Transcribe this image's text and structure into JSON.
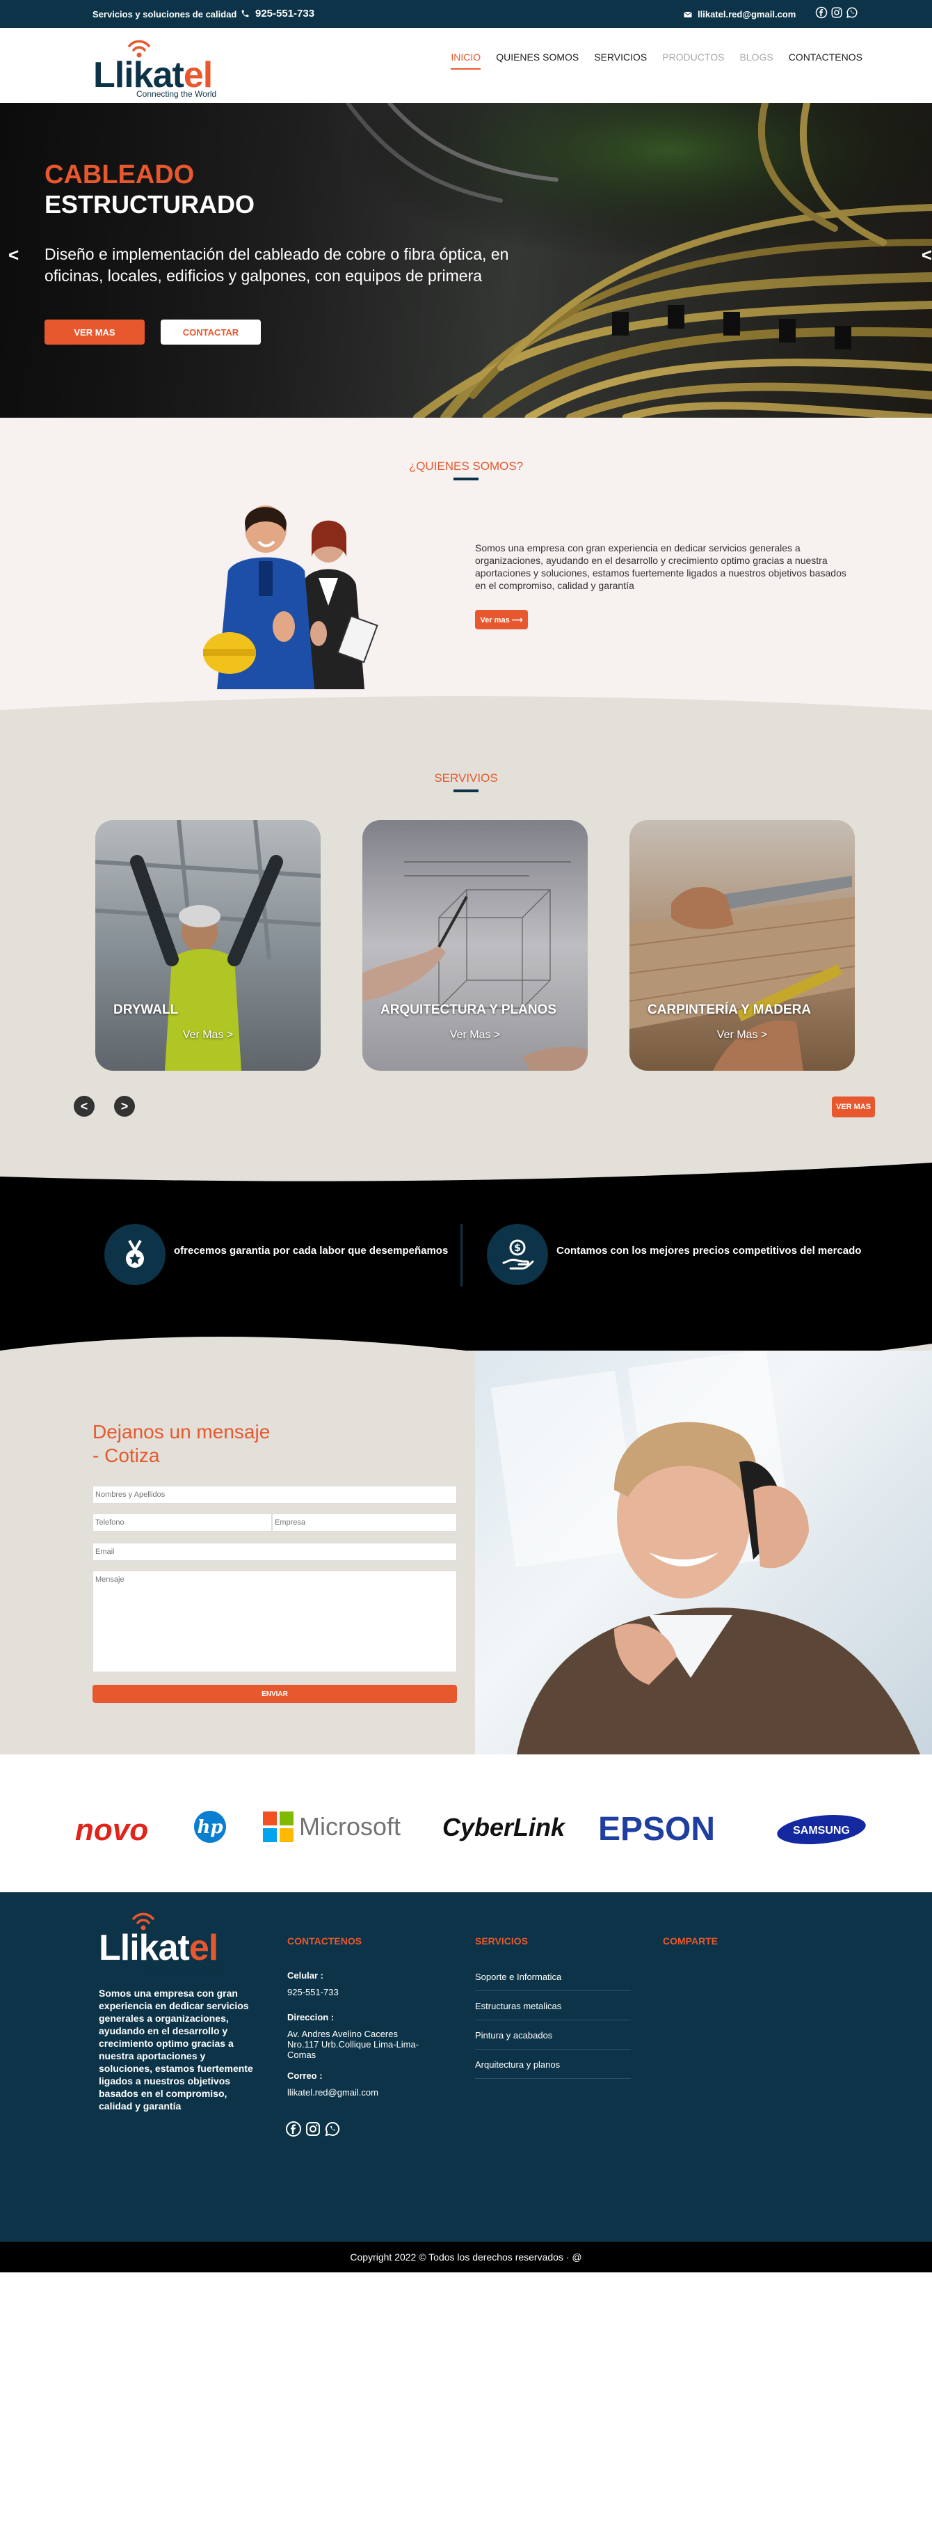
{
  "topbar": {
    "tagline": "Servicios y soluciones de calidad",
    "phone": "925-551-733",
    "email": "llikatel.red@gmail.com"
  },
  "header": {
    "logo_main": "Llikat",
    "logo_accent": "el",
    "logo_sub": "Connecting the World",
    "nav": [
      {
        "label": "INICIO"
      },
      {
        "label": "QUIENES SOMOS"
      },
      {
        "label": "SERVICIOS"
      },
      {
        "label": "PRODUCTOS"
      },
      {
        "label": "BLOGS"
      },
      {
        "label": "CONTACTENOS"
      }
    ]
  },
  "hero": {
    "title_1": "CABLEADO",
    "title_2": "ESTRUCTURADO",
    "description": "Diseño e implementación del cableado de cobre o fibra óptica, en oficinas, locales, edificios y galpones, con equipos de primera",
    "btn_primary": "VER MAS",
    "btn_secondary": "CONTACTAR",
    "prev": "<",
    "next": "<"
  },
  "about": {
    "title": "¿QUIENES SOMOS?",
    "text": "Somos una empresa con gran experiencia en dedicar servicios generales a organizaciones, ayudando en el desarrollo y crecimiento optimo gracias a nuestra aportaciones y soluciones, estamos fuertemente ligados a nuestros objetivos basados en el compromiso, calidad y garantía",
    "button": "Ver mas ⟶"
  },
  "services": {
    "title": "SERVIVIOS",
    "cards": [
      {
        "title": "DRYWALL",
        "link": "Ver Mas >"
      },
      {
        "title": "ARQUITECTURA Y PLANOS",
        "link": "Ver Mas >"
      },
      {
        "title": "CARPINTERÍA Y MADERA",
        "link": "Ver Mas >"
      }
    ],
    "prev": "<",
    "next": ">",
    "button": "VER MAS"
  },
  "features": [
    {
      "text": "ofrecemos garantia por cada labor que desempeñamos",
      "icon": "medal-icon"
    },
    {
      "text": "Contamos con los mejores precios competitivos del mercado",
      "icon": "money-hand-icon"
    }
  ],
  "contact": {
    "title_1": "Dejanos un mensaje",
    "title_2": "- Cotiza",
    "name_placeholder": "Nombres y Apellidos",
    "phone_placeholder": "Telefono",
    "company_placeholder": "Empresa",
    "email_placeholder": "Email",
    "message_placeholder": "Mensaje",
    "submit": "ENVIAR"
  },
  "brands": [
    "novo",
    "hp",
    "Microsoft",
    "CyberLink",
    "EPSON",
    "SAMSUNG"
  ],
  "footer": {
    "about": "Somos una empresa con gran experiencia en dedicar servicios generales a organizaciones, ayudando en el desarrollo y crecimiento optimo gracias a nuestra aportaciones y soluciones, estamos fuertemente ligados a nuestros objetivos basados en el compromiso, calidad y garantía",
    "contact_head": "CONTACTENOS",
    "cel_label": "Celular :",
    "cel_value": "925-551-733",
    "dir_label": "Direccion :",
    "dir_value": "Av. Andres Avelino Caceres Nro.117 Urb.Collique Lima-Lima-Comas",
    "mail_label": "Correo :",
    "mail_value": "llikatel.red@gmail.com",
    "services_head": "SERVICIOS",
    "services": [
      "Soporte e Informatica",
      "Estructuras metalicas",
      "Pintura y acabados",
      "Arquitectura y planos"
    ],
    "share_head": "COMPARTE"
  },
  "copyright": "Copyright 2022 © Todos los derechos reservados · @",
  "colors": {
    "navy": "#0c3347",
    "orange": "#e8582e"
  }
}
